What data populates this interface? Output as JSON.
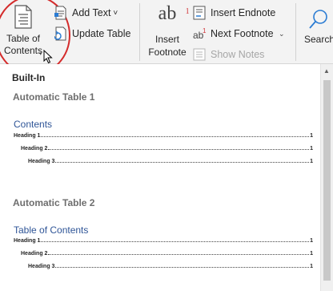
{
  "ribbon": {
    "toc_button": {
      "line1": "Table of",
      "line2": "Contents",
      "caret": "▾"
    },
    "add_text": {
      "label": "Add Text",
      "caret": "˅"
    },
    "update_table": {
      "label": "Update Table"
    },
    "insert_footnote": {
      "icon_text": "ab",
      "icon_sup": "1",
      "line1": "Insert",
      "line2": "Footnote"
    },
    "insert_endnote": {
      "label": "Insert Endnote"
    },
    "next_footnote": {
      "label": "Next Footnote",
      "caret": "⌄"
    },
    "show_notes": {
      "label": "Show Notes"
    },
    "search": {
      "label": "Search"
    }
  },
  "gallery": {
    "section_label": "Built-In",
    "entries": [
      {
        "title": "Automatic Table 1",
        "toc_heading": "Contents",
        "lines": [
          {
            "text": "Heading 1",
            "page": "1"
          },
          {
            "text": "Heading 2",
            "page": "1"
          },
          {
            "text": "Heading 3",
            "page": "1"
          }
        ]
      },
      {
        "title": "Automatic Table 2",
        "toc_heading": "Table of Contents",
        "lines": [
          {
            "text": "Heading 1",
            "page": "1"
          },
          {
            "text": "Heading 2",
            "page": "1"
          },
          {
            "text": "Heading 3",
            "page": "1"
          }
        ]
      }
    ]
  },
  "colors": {
    "highlight": "#d42b2b",
    "toc_heading": "#2f5597",
    "footnote_superscript": "#d13438"
  }
}
